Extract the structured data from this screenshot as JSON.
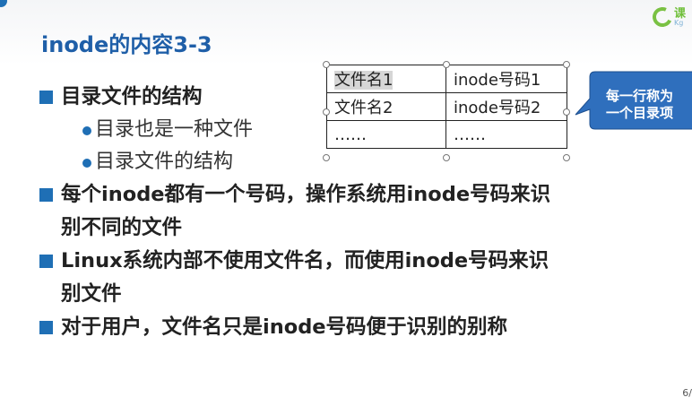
{
  "logo": {
    "line1": "课",
    "line2": "Kg"
  },
  "title": "inode的内容3-3",
  "bullets": [
    {
      "text": "目录文件的结构",
      "sub": [
        "目录也是一种文件",
        "目录文件的结构"
      ]
    },
    {
      "line1": "每个inode都有一个号码，操作系统用inode号码来识",
      "line2": "别不同的文件"
    },
    {
      "line1": "Linux系统内部不使用文件名，而使用inode号码来识",
      "line2": "别文件"
    },
    {
      "line1": "对于用户，文件名只是inode号码便于识别的别称"
    }
  ],
  "table": {
    "rows": [
      [
        "文件名1",
        "inode号码1"
      ],
      [
        "文件名2",
        "inode号码2"
      ],
      [
        "……",
        "……"
      ]
    ]
  },
  "callout": {
    "line1": "每一行称为",
    "line2": "一个目录项"
  },
  "page_number": "6/",
  "colors": {
    "accent": "#1f6fb5",
    "title": "#1f5fa8",
    "callout": "#2f6fbd"
  }
}
